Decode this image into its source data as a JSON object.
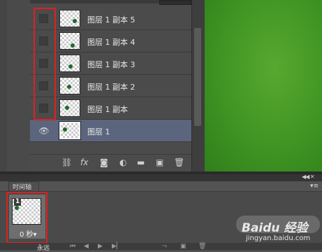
{
  "layers": [
    {
      "name": "图层 1 副本 5",
      "visible": false,
      "selected": false
    },
    {
      "name": "图层 1 副本 4",
      "visible": false,
      "selected": false
    },
    {
      "name": "图层 1 副本 3",
      "visible": false,
      "selected": false
    },
    {
      "name": "图层 1 副本 2",
      "visible": false,
      "selected": false
    },
    {
      "name": "图层 1 副本",
      "visible": false,
      "selected": false
    },
    {
      "name": "图层 1",
      "visible": true,
      "selected": true
    }
  ],
  "layer_toolbar": {
    "link_icon": "link-icon",
    "fx_label": "fx",
    "mask_icon": "mask-icon",
    "adjust_icon": "adjustment-icon",
    "group_icon": "folder-icon",
    "new_icon": "new-layer-icon",
    "delete_icon": "trash-icon"
  },
  "timeline": {
    "tab_label": "时间轴",
    "frame_number": "1",
    "frame_delay": "0 秒▾",
    "loop_label": "永远"
  },
  "watermark": {
    "text": "Baidu 经验",
    "sub": "jingyan.baidu.com"
  },
  "colors": {
    "highlight_box": "#e02020",
    "selected_row": "#5b657d",
    "canvas_green": "#3f9423"
  }
}
